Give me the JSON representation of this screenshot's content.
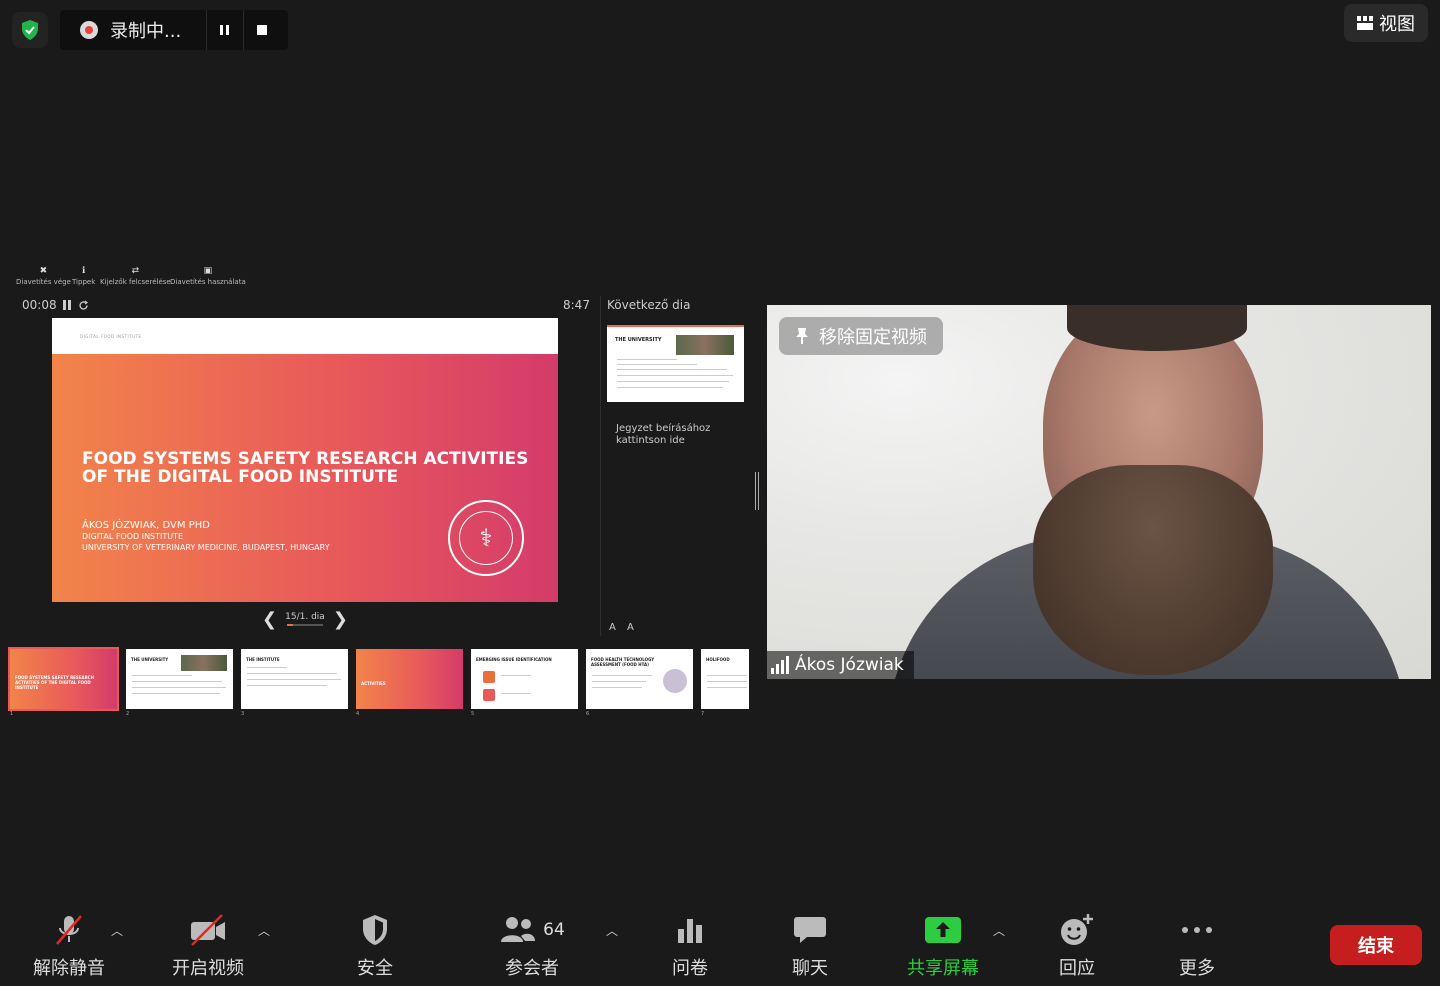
{
  "recording": {
    "label": "录制中..."
  },
  "view_button": {
    "label": "视图"
  },
  "presenter_tools": [
    {
      "label": "Diavetítés vége",
      "icon": "close-icon"
    },
    {
      "label": "Tippek",
      "icon": "info-icon"
    },
    {
      "label": "Kijelzők felcserélése",
      "icon": "swap-icon"
    },
    {
      "label": "Diavetítés használata",
      "icon": "screen-icon"
    }
  ],
  "presenter": {
    "elapsed": "00:08",
    "clock": "8:47",
    "slide_counter": "15/1. dia",
    "next_slide_label": "Következő dia",
    "notes_placeholder": "Jegyzet beírásához kattintson ide",
    "font_buttons": "A A"
  },
  "current_slide": {
    "header": "DIGITAL FOOD INSTITUTE",
    "title_line1": "FOOD SYSTEMS SAFETY RESEARCH ACTIVITIES",
    "title_line2": "OF THE DIGITAL FOOD INSTITUTE",
    "author": "ÁKOS JÓZWIAK, DVM PHD",
    "org1": "DIGITAL FOOD INSTITUTE",
    "org2": "UNIVERSITY OF VETERINARY MEDICINE, BUDAPEST, HUNGARY",
    "accent_start": "#f2844a",
    "accent_end": "#d43b6a"
  },
  "next_slide": {
    "title": "THE UNIVERSITY"
  },
  "thumbnails": [
    {
      "num": "1",
      "title": "FOOD SYSTEMS SAFETY RESEARCH ACTIVITIES OF THE DIGITAL FOOD INSTITUTE"
    },
    {
      "num": "2",
      "title": "THE UNIVERSITY"
    },
    {
      "num": "3",
      "title": "THE INSTITUTE"
    },
    {
      "num": "4",
      "title": "ACTIVITIES"
    },
    {
      "num": "5",
      "title": "EMERGING ISSUE IDENTIFICATION"
    },
    {
      "num": "6",
      "title": "FOOD HEALTH TECHNOLOGY ASSESSMENT (FOOD HTA)"
    },
    {
      "num": "7",
      "title": "HOLIFOOD"
    }
  ],
  "video": {
    "unpin_label": "移除固定视频",
    "participant_name": "Ákos Józwiak"
  },
  "toolbar": {
    "unmute": "解除静音",
    "start_video": "开启视频",
    "security": "安全",
    "participants": "参会者",
    "participant_count": "64",
    "polls": "问卷",
    "chat": "聊天",
    "share_screen": "共享屏幕",
    "reactions": "回应",
    "more": "更多",
    "end": "结束"
  },
  "colors": {
    "share_green": "#2ecc40",
    "end_red": "#c61e1e",
    "secure_green": "#23b34a"
  }
}
